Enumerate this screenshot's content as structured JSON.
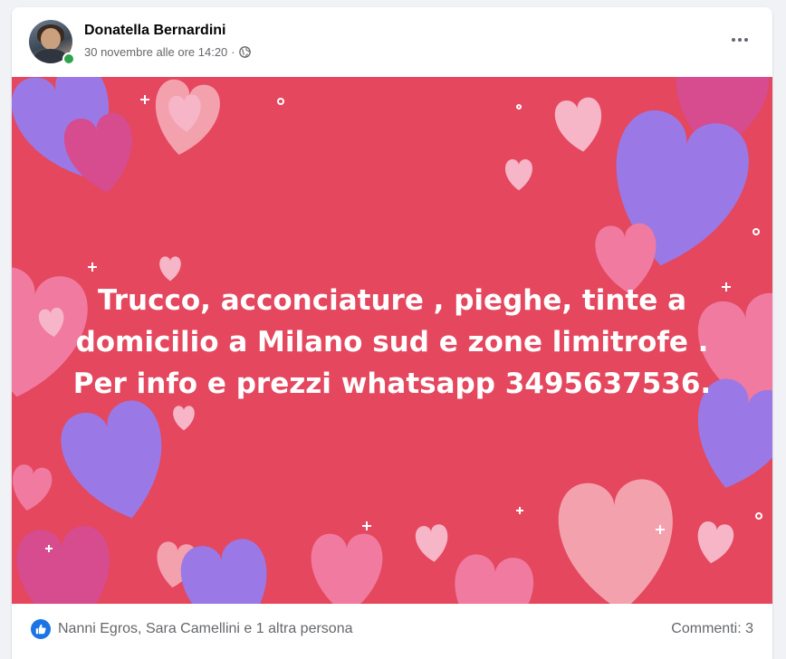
{
  "post": {
    "author": "Donatella Bernardini",
    "timestamp": "30 novembre alle ore 14:20",
    "separator": "·",
    "privacy_icon": "globe-icon",
    "more_icon": "more-options-icon",
    "image_text": {
      "line1": "Trucco, acconciature , pieghe, tinte a",
      "line2": "domicilio a Milano sud e zone limitrofe .",
      "line3": "Per info e prezzi whatsapp 3495637536."
    },
    "image_background": "#e4475e",
    "reactions": {
      "icon": "like-icon",
      "text": "Nanni Egros, Sara Camellini e 1 altra persona"
    },
    "comments": "Commenti: 3"
  },
  "colors": {
    "like_blue": "#1b74e4",
    "online_green": "#31a24c",
    "heart_purple": "#9a79e6",
    "heart_pink": "#f07aa0"
  }
}
